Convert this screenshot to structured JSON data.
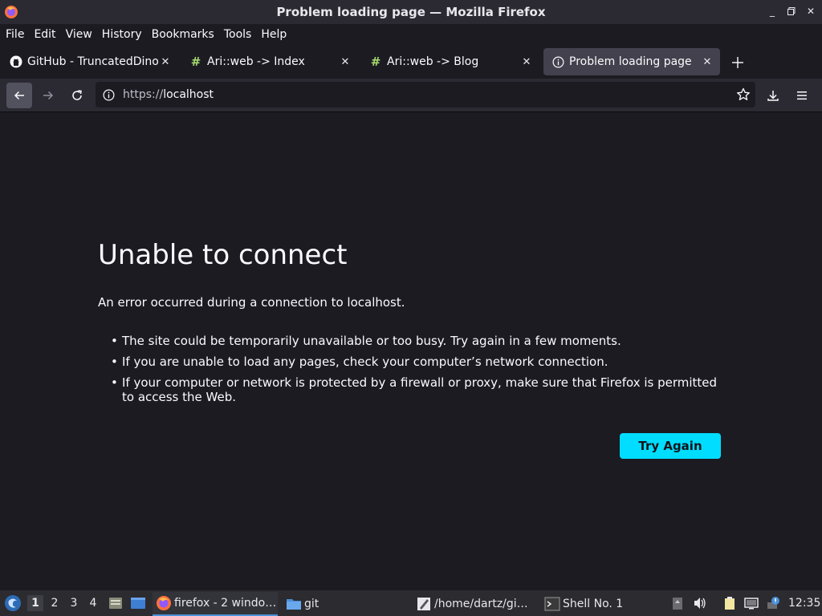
{
  "window": {
    "title": "Problem loading page — Mozilla Firefox"
  },
  "menu": {
    "items": [
      "File",
      "Edit",
      "View",
      "History",
      "Bookmarks",
      "Tools",
      "Help"
    ]
  },
  "tabs": [
    {
      "label": "GitHub - TruncatedDinosaur",
      "icon": "github-icon",
      "active": false
    },
    {
      "label": "Ari::web -> Index",
      "icon": "hash-favicon-icon",
      "active": false
    },
    {
      "label": "Ari::web -> Blog",
      "icon": "hash-favicon-icon",
      "active": false
    },
    {
      "label": "Problem loading page",
      "icon": "info-icon",
      "active": true
    }
  ],
  "navbar": {
    "url_scheme": "https://",
    "url_host": "localhost"
  },
  "error": {
    "title": "Unable to connect",
    "description": "An error occurred during a connection to localhost.",
    "items": [
      "The site could be temporarily unavailable or too busy. Try again in a few moments.",
      "If you are unable to load any pages, check your computer’s network connection.",
      "If your computer or network is protected by a firewall or proxy, make sure that Firefox is permitted to access the Web."
    ],
    "button_label": "Try Again"
  },
  "taskbar": {
    "workspaces": [
      "1",
      "2",
      "3",
      "4"
    ],
    "active_workspace": "1",
    "tasks": [
      {
        "label": "firefox - 2 windo…",
        "icon": "firefox-icon",
        "active": true
      },
      {
        "label": "git",
        "icon": "folder-icon",
        "active": false
      },
      {
        "label": "/home/dartz/gi…",
        "icon": "text-editor-icon",
        "active": false
      },
      {
        "label": "Shell No. 1",
        "icon": "terminal-icon",
        "active": false
      }
    ],
    "clock": "12:35"
  },
  "colors": {
    "accent": "#00ddff",
    "background": "#1c1b22",
    "toolbar": "#2b2a33",
    "active_tab": "#42414d"
  }
}
